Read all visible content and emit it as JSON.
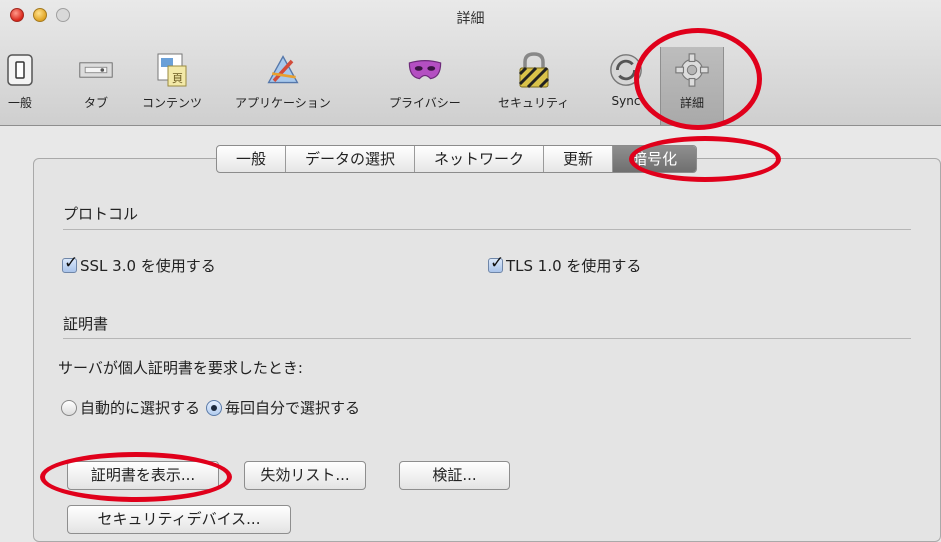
{
  "window": {
    "title": "詳細"
  },
  "toolbar": {
    "items": [
      {
        "label": "一般",
        "icon": "general-switch-icon"
      },
      {
        "label": "タブ",
        "icon": "tabs-icon"
      },
      {
        "label": "コンテンツ",
        "icon": "contents-icon"
      },
      {
        "label": "アプリケーション",
        "icon": "applications-icon"
      },
      {
        "label": "プライバシー",
        "icon": "privacy-mask-icon"
      },
      {
        "label": "セキュリティ",
        "icon": "lock-icon"
      },
      {
        "label": "Sync",
        "icon": "sync-icon"
      },
      {
        "label": "詳細",
        "icon": "gear-icon"
      }
    ],
    "selected": "詳細"
  },
  "tabs": {
    "items": [
      "一般",
      "データの選択",
      "ネットワーク",
      "更新",
      "暗号化"
    ],
    "selected": "暗号化"
  },
  "protocol": {
    "title": "プロトコル",
    "ssl_label": "SSL 3.0 を使用する",
    "ssl_checked": true,
    "tls_label": "TLS 1.0 を使用する",
    "tls_checked": true
  },
  "certificates": {
    "title": "証明書",
    "prompt": "サーバが個人証明書を要求したとき:",
    "radio_auto": "自動的に選択する",
    "radio_ask": "毎回自分で選択する",
    "selected": "毎回自分で選択する",
    "buttons": {
      "view": "証明書を表示...",
      "revocation": "失効リスト...",
      "validation": "検証...",
      "devices": "セキュリティデバイス..."
    }
  },
  "colors": {
    "annotation": "#e0001b",
    "selected_tab": "#7a7a7a"
  }
}
